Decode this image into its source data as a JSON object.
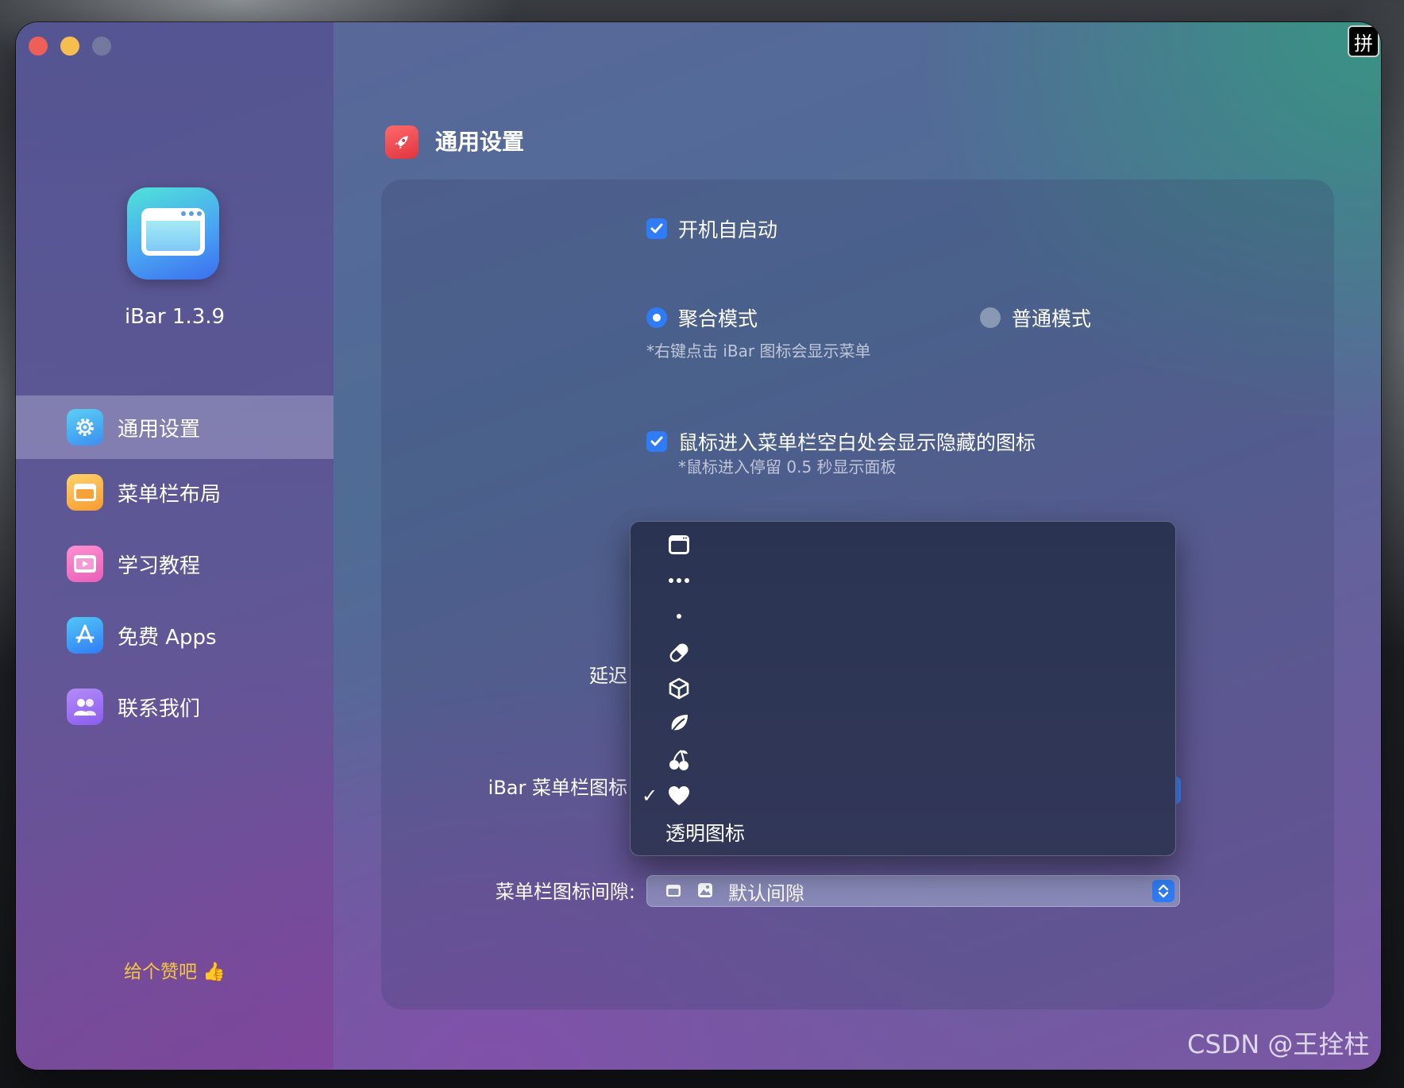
{
  "system": {
    "input_method": "拼",
    "watermark": "CSDN @王拴柱"
  },
  "app": {
    "version": "iBar 1.3.9"
  },
  "sidebar": {
    "items": [
      {
        "label": "通用设置",
        "icon": "gear-icon",
        "active": true
      },
      {
        "label": "菜单栏布局",
        "icon": "menubar-layout-icon",
        "active": false
      },
      {
        "label": "学习教程",
        "icon": "video-tutorial-icon",
        "active": false
      },
      {
        "label": "免费 Apps",
        "icon": "app-store-icon",
        "active": false
      },
      {
        "label": "联系我们",
        "icon": "contacts-icon",
        "active": false
      }
    ],
    "like": "给个赞吧 👍"
  },
  "header": {
    "title": "通用设置",
    "icon": "rocket-icon"
  },
  "settings": {
    "launch_at_login": {
      "label": "开机自启动",
      "checked": true
    },
    "mode": {
      "aggregate": {
        "label": "聚合模式",
        "selected": true
      },
      "normal": {
        "label": "普通模式",
        "selected": false
      },
      "hint": "*右键点击 iBar 图标会显示菜单"
    },
    "hover_show": {
      "label": "鼠标进入菜单栏空白处会显示隐藏的图标",
      "checked": true,
      "hint": "*鼠标进入停留 0.5 秒显示面板"
    },
    "delay_label": "延迟",
    "menubar_icon_label": "iBar 菜单栏图标",
    "spacing": {
      "label": "菜单栏图标间隙:",
      "value": "默认间隙"
    }
  },
  "dropdown": {
    "items": [
      {
        "icon": "window-icon",
        "checked": false
      },
      {
        "icon": "ellipsis-icon",
        "checked": false
      },
      {
        "icon": "dot-icon",
        "checked": false
      },
      {
        "icon": "pill-icon",
        "checked": false
      },
      {
        "icon": "cube-icon",
        "checked": false
      },
      {
        "icon": "leaf-icon",
        "checked": false
      },
      {
        "icon": "cherries-icon",
        "checked": false
      },
      {
        "icon": "heart-icon",
        "checked": true
      }
    ],
    "text_option": "透明图标",
    "check_mark": "✓"
  },
  "colors": {
    "accent": "#2f7cf6",
    "like": "#f4c542",
    "close": "#ed5f57",
    "minimize": "#f5be4f"
  }
}
